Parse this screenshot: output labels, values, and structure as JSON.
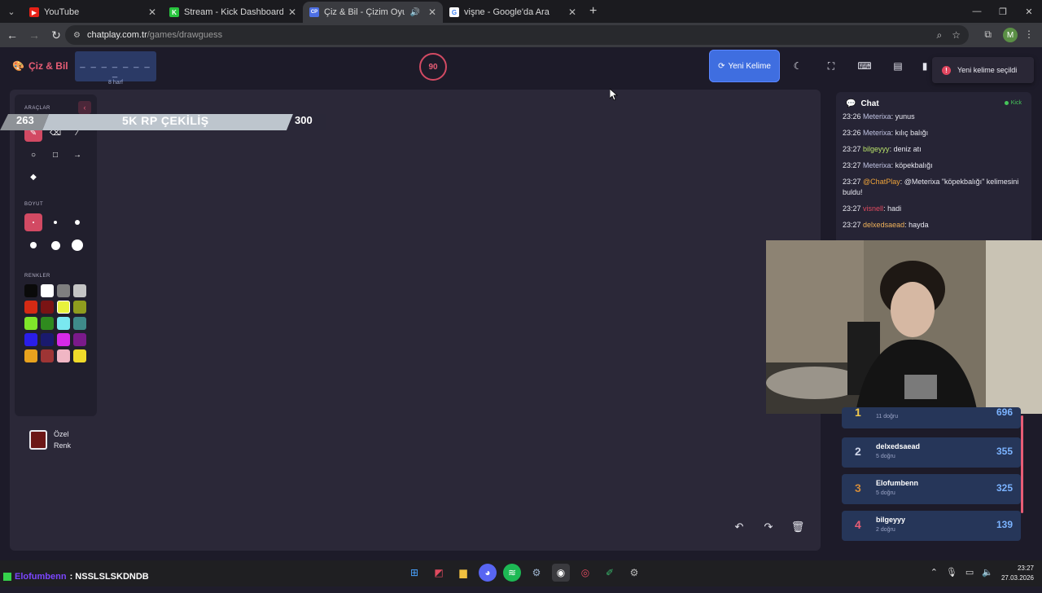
{
  "browser": {
    "tabs": [
      {
        "title": "YouTube",
        "fav_color": "#e62117",
        "fav_glyph": "▶"
      },
      {
        "title": "Stream - Kick Dashboard",
        "fav_color": "#28c43e",
        "fav_glyph": "K"
      },
      {
        "title": "Çiz & Bil - Çizim Oyunu",
        "fav_color": "#4d6fe3",
        "fav_glyph": "CP"
      },
      {
        "title": "vişne - Google'da Ara",
        "fav_color": "#4285f4",
        "fav_glyph": "G"
      }
    ],
    "url_host": "chatplay.com.tr",
    "url_path": "/games/drawguess",
    "profile_initial": "M"
  },
  "game": {
    "logo": "Çiz & Bil",
    "word_dashes": "_ _ _ _ _ _ _ _",
    "word_length": "8 harf",
    "timer": "90",
    "new_word_button": "Yeni Kelime",
    "toast": "Yeni kelime seçildi"
  },
  "tools": {
    "tools_title": "ARAÇLAR",
    "size_title": "BOYUT",
    "colors_title": "RENKLER",
    "custom_label_1": "Özel",
    "custom_label_2": "Renk",
    "colors": [
      "#0a0a0a",
      "#ffffff",
      "#7f7f7f",
      "#c4c4c4",
      "#d42a14",
      "#7a1414",
      "#e7f23c",
      "#8f9c1e",
      "#7fe52a",
      "#2f8a1e",
      "#7ae8f0",
      "#3f8a8a",
      "#2a1ee8",
      "#1a1a6e",
      "#d62ae8",
      "#7a1a8a",
      "#e8a21e",
      "#9e3535",
      "#f0b6c4",
      "#f0da2a"
    ]
  },
  "banner": {
    "left_value": "263",
    "center_text": "5K RP ÇEKİLİŞ",
    "right_value": "300"
  },
  "chat": {
    "title": "Chat",
    "source": "Kick",
    "messages": [
      {
        "time": "23:26",
        "user": "Meterixa",
        "text": ": yunus",
        "color": "#c0c3e2"
      },
      {
        "time": "23:26",
        "user": "Meterixa",
        "text": ": kılıç balığı",
        "color": "#c0c3e2"
      },
      {
        "time": "23:27",
        "user": "bilgeyyy",
        "text": ": deniz atı",
        "color": "#b9e36b"
      },
      {
        "time": "23:27",
        "user": "Meterixa",
        "text": ": köpekbalığı",
        "color": "#c0c3e2"
      },
      {
        "time": "23:27",
        "user": "@ChatPlay",
        "text": ": @Meterixa \"köpekbalığı\" kelimesini buldu!",
        "color": "#f0a43a"
      },
      {
        "time": "23:27",
        "user": "visnell",
        "text": ": hadi",
        "color": "#e04a5f"
      },
      {
        "time": "23:27",
        "user": "delxedsaead",
        "text": ": hayda",
        "color": "#f0b25a"
      }
    ]
  },
  "leaderboard": [
    {
      "rank": "1",
      "name": "",
      "sub": "11 doğru",
      "score": "696",
      "rank_color": "#f2c94c"
    },
    {
      "rank": "2",
      "name": "delxedsaead",
      "sub": "5 doğru",
      "score": "355",
      "rank_color": "#cfd6ea"
    },
    {
      "rank": "3",
      "name": "Elofumbenn",
      "sub": "5 doğru",
      "score": "325",
      "rank_color": "#d08a3a"
    },
    {
      "rank": "4",
      "name": "bilgeyyy",
      "sub": "2 doğru",
      "score": "139",
      "rank_color": "#e85d75"
    }
  ],
  "taskbar": {
    "ticker_user": "Elofumbenn",
    "ticker_text": ": NSSLSLSKDNDB",
    "time": "23:27",
    "date": "27.03.2026"
  }
}
